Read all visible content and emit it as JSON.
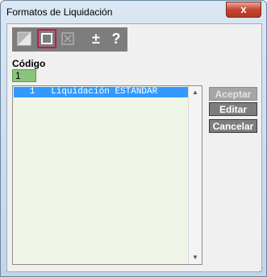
{
  "window": {
    "title": "Formatos de Liquidación",
    "close_glyph": "x"
  },
  "toolbar": {
    "buttons": [
      {
        "icon": "half-square-icon",
        "state": "normal"
      },
      {
        "icon": "square-icon",
        "state": "active"
      },
      {
        "icon": "x-square-icon",
        "state": "disabled"
      },
      {
        "icon": "plus-minus-icon",
        "glyph": "±",
        "state": "normal"
      },
      {
        "icon": "help-icon",
        "glyph": "?",
        "state": "normal"
      }
    ]
  },
  "form": {
    "codigo_label": "Código",
    "codigo_value": "1"
  },
  "list": {
    "rows": [
      {
        "code": "1",
        "name": "Liquidación ESTANDAR",
        "selected": true
      }
    ],
    "row_text": "   1   Liquidación ESTANDAR"
  },
  "actions": {
    "aceptar": "Aceptar",
    "editar": "Editar",
    "cancelar": "Cancelar"
  },
  "colors": {
    "toolbar_bg": "#7d7d7d",
    "input_bg": "#89c47a",
    "list_bg": "#eef5e6",
    "selection": "#3399ff",
    "close_red": "#c7442f",
    "active_border": "#c2185b"
  }
}
